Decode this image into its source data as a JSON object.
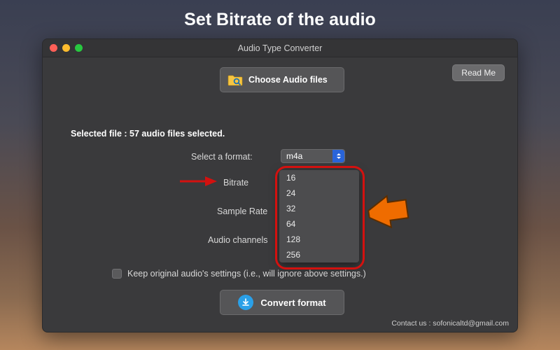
{
  "headline": "Set Bitrate of the audio",
  "window": {
    "title": "Audio Type Converter"
  },
  "readme": {
    "label": "Read Me"
  },
  "choose": {
    "label": "Choose Audio files"
  },
  "selected_file": {
    "text": "Selected file : 57 audio files selected."
  },
  "format": {
    "label": "Select a format:",
    "value": "m4a"
  },
  "bitrate": {
    "label": "Bitrate",
    "options": [
      "16",
      "24",
      "32",
      "64",
      "128",
      "256"
    ]
  },
  "sample_rate": {
    "label": "Sample Rate"
  },
  "channels": {
    "label": "Audio channels"
  },
  "keep_original": {
    "label": "Keep original audio's settings (i.e., will ignore above settings.)"
  },
  "convert": {
    "label": "Convert format"
  },
  "contact": {
    "text": "Contact us : sofonicaltd@gmail.com"
  }
}
